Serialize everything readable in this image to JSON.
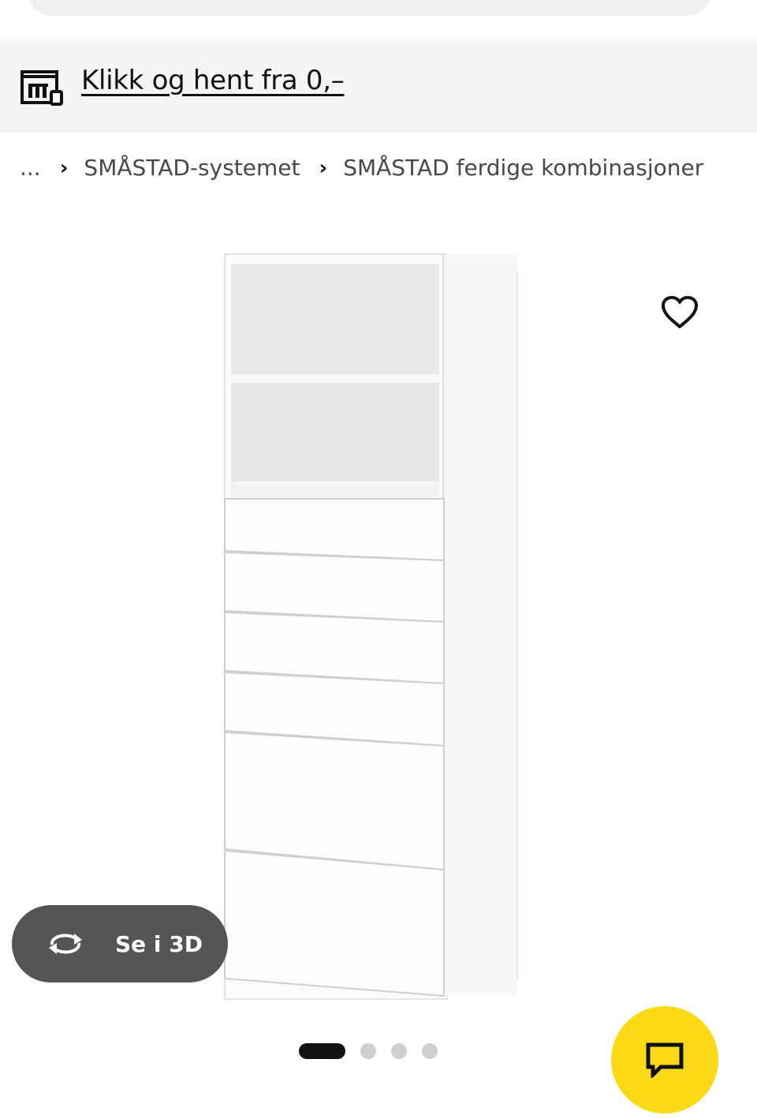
{
  "search": {
    "placeholder": ""
  },
  "pickup": {
    "icon": "store-pickup-icon",
    "link_text": "Klikk og hent fra 0,–"
  },
  "breadcrumb": {
    "ellipsis": "...",
    "separator": "›",
    "items": [
      {
        "label": "SMÅSTAD-systemet"
      },
      {
        "label": "SMÅSTAD ferdige kombinasjoner"
      }
    ]
  },
  "product": {
    "image_icon": "white-bookcase-with-drawers-image",
    "favourite_icon": "heart-outline-icon"
  },
  "view3d": {
    "icon": "rotate-3d-icon",
    "label": "Se i 3D"
  },
  "carousel": {
    "total": 4,
    "active_index": 0
  },
  "chat": {
    "icon": "chat-bubble-icon"
  },
  "colors": {
    "accent_yellow": "#fcd916",
    "pill_gray": "#555555",
    "bar_bg": "#f5f5f5"
  }
}
